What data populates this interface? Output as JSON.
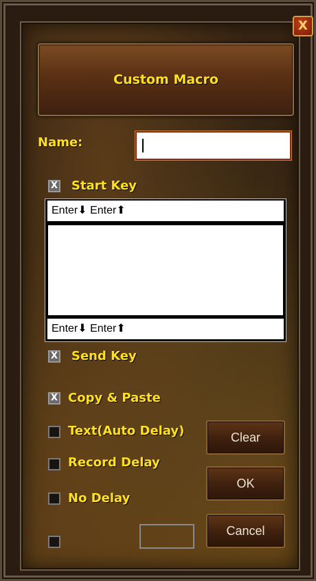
{
  "window": {
    "title": "Custom Macro",
    "close_label": "X"
  },
  "name_field": {
    "label": "Name:",
    "value": ""
  },
  "start_key": {
    "label": "Start Key",
    "checked": true,
    "checkbox_mark": "X",
    "top_line": "Enter⬇ Enter⬆",
    "bottom_line": "Enter⬇ Enter⬆"
  },
  "send_key": {
    "label": "Send Key",
    "checked": true,
    "checkbox_mark": "X"
  },
  "options": [
    {
      "label": "Copy & Paste",
      "checked": true,
      "mark": "X"
    },
    {
      "label": "Text(Auto Delay)",
      "checked": false,
      "mark": ""
    },
    {
      "label": "Record Delay",
      "checked": false,
      "mark": ""
    },
    {
      "label": "No Delay",
      "checked": false,
      "mark": ""
    },
    {
      "label": "",
      "checked": false,
      "mark": ""
    }
  ],
  "buttons": {
    "clear": "Clear",
    "ok": "OK",
    "cancel": "Cancel"
  },
  "colors": {
    "label_yellow": "#ffe020",
    "button_text": "#ece4d4",
    "close_red": "#c0401a"
  }
}
